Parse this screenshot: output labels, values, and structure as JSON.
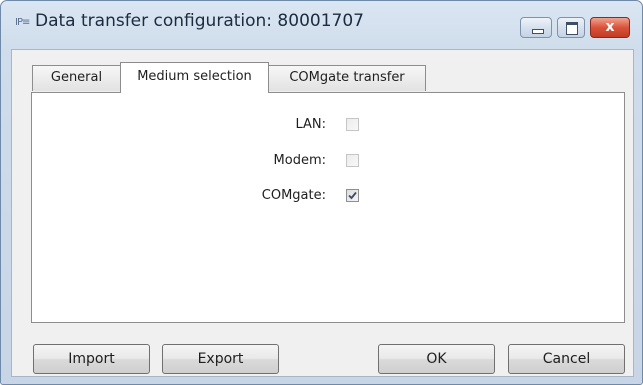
{
  "window": {
    "app_icon_text": "IP≡",
    "title": "Data transfer configuration: 80001707",
    "close_glyph": "x"
  },
  "tabs": [
    {
      "label": "General",
      "selected": false
    },
    {
      "label": "Medium selection",
      "selected": true
    },
    {
      "label": "COMgate transfer",
      "selected": false
    }
  ],
  "medium": {
    "lan": {
      "label": "LAN:",
      "checked": false,
      "enabled": false
    },
    "modem": {
      "label": "Modem:",
      "checked": false,
      "enabled": false
    },
    "comgate": {
      "label": "COMgate:",
      "checked": true,
      "enabled": true
    }
  },
  "buttons": {
    "import": "Import",
    "export": "Export",
    "ok": "OK",
    "cancel": "Cancel"
  },
  "colors": {
    "close_accent": "#d9533a",
    "frame": "#cfdceb"
  }
}
